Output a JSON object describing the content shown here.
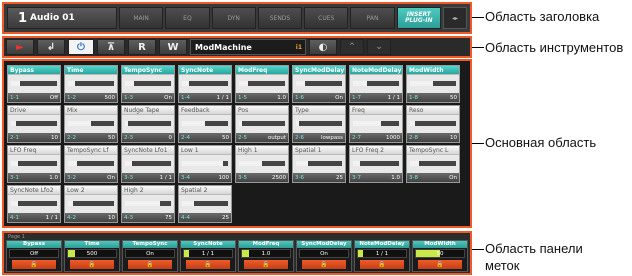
{
  "header": {
    "track_number": "1",
    "track_name": "Audio 01",
    "tabs": [
      "MAIN",
      "EQ",
      "DYN",
      "SENDS",
      "CUES",
      "PAN"
    ],
    "active_tab": "INSERT PLUG-IN",
    "meter_label": "◂▸"
  },
  "toolbar": {
    "record_icon": "►",
    "undo_icon": "↲",
    "power_icon": "⏻",
    "btn_a": "⊼",
    "btn_r": "R",
    "btn_w": "W",
    "plugin_name": "ModMachine",
    "plugin_index": "i1",
    "settings_icon": "◐",
    "up_icon": "⌃",
    "down_icon": "⌄"
  },
  "params": [
    {
      "name": "Bypass",
      "idx": "1-1",
      "val": "Off",
      "level": 0.2,
      "sel": true
    },
    {
      "name": "Time",
      "idx": "1-2",
      "val": "500",
      "level": 0.15,
      "sel": true
    },
    {
      "name": "TempoSync",
      "idx": "1-3",
      "val": "On",
      "level": 0.2,
      "sel": true
    },
    {
      "name": "SyncNote",
      "idx": "1-4",
      "val": "1 / 1",
      "level": 0.15,
      "sel": true
    },
    {
      "name": "ModFreq",
      "idx": "1-5",
      "val": "1.0",
      "level": 0.2,
      "sel": true
    },
    {
      "name": "SyncModDelay",
      "idx": "1-6",
      "val": "On",
      "level": 0.2,
      "sel": true
    },
    {
      "name": "NoteModDelay",
      "idx": "1-7",
      "val": "1 / 1",
      "level": 0.3,
      "sel": true
    },
    {
      "name": "ModWidth",
      "idx": "1-8",
      "val": "50",
      "level": 0.5,
      "sel": true
    },
    {
      "name": "Drive",
      "idx": "2-1",
      "val": "10",
      "level": 0.1,
      "sel": false
    },
    {
      "name": "Mix",
      "idx": "2-2",
      "val": "50",
      "level": 0.5,
      "sel": false
    },
    {
      "name": "Nudge Tape",
      "idx": "2-3",
      "val": "0",
      "level": 0.05,
      "sel": false
    },
    {
      "name": "Feedback",
      "idx": "2-4",
      "val": "50",
      "level": 0.5,
      "sel": false
    },
    {
      "name": "Pos",
      "idx": "2-5",
      "val": "output",
      "level": 0.05,
      "sel": false
    },
    {
      "name": "Type",
      "idx": "2-6",
      "val": "lowpass",
      "level": 0.05,
      "sel": false
    },
    {
      "name": "Freq",
      "idx": "2-7",
      "val": "1000",
      "level": 0.6,
      "sel": false
    },
    {
      "name": "Reso",
      "idx": "2-8",
      "val": "10",
      "level": 0.1,
      "sel": false
    },
    {
      "name": "LFO Freq",
      "idx": "3-1",
      "val": "1.0",
      "level": 0.15,
      "sel": false
    },
    {
      "name": "TempoSync Lf",
      "idx": "3-2",
      "val": "On",
      "level": 0.2,
      "sel": false
    },
    {
      "name": "SyncNote Lfo1",
      "idx": "3-3",
      "val": "1 / 1",
      "level": 0.15,
      "sel": false
    },
    {
      "name": "Low 1",
      "idx": "3-4",
      "val": "100",
      "level": 0.9,
      "sel": false
    },
    {
      "name": "High 1",
      "idx": "3-5",
      "val": "2500",
      "level": 0.5,
      "sel": false
    },
    {
      "name": "Spatial 1",
      "idx": "3-6",
      "val": "25",
      "level": 0.25,
      "sel": false
    },
    {
      "name": "LFO Freq 2",
      "idx": "3-7",
      "val": "1.0",
      "level": 0.15,
      "sel": false
    },
    {
      "name": "TempoSync L",
      "idx": "3-8",
      "val": "On",
      "level": 0.2,
      "sel": false
    },
    {
      "name": "SyncNote Lfo2",
      "idx": "4-1",
      "val": "1 / 1",
      "level": 0.15,
      "sel": false
    },
    {
      "name": "Low 2",
      "idx": "4-2",
      "val": "10",
      "level": 0.1,
      "sel": false
    },
    {
      "name": "High 2",
      "idx": "4-3",
      "val": "75",
      "level": 0.75,
      "sel": false
    },
    {
      "name": "Spatial 2",
      "idx": "4-4",
      "val": "25",
      "level": 0.25,
      "sel": false
    }
  ],
  "bank": {
    "label": "Page 1",
    "lock_icon": "🔒",
    "items": [
      {
        "name": "Bypass",
        "val": "Off",
        "level": 0.0
      },
      {
        "name": "Time",
        "val": "500",
        "level": 0.15
      },
      {
        "name": "TempoSync",
        "val": "On",
        "level": 0.0
      },
      {
        "name": "SyncNote",
        "val": "1 / 1",
        "level": 0.1
      },
      {
        "name": "ModFreq",
        "val": "1.0",
        "level": 0.15
      },
      {
        "name": "SyncModDelay",
        "val": "On",
        "level": 0.0
      },
      {
        "name": "NoteModDelay",
        "val": "1 / 1",
        "level": 0.1
      },
      {
        "name": "ModWidth",
        "val": "50",
        "level": 0.5
      }
    ]
  },
  "callouts": {
    "title_area": "Область заголовка",
    "tools_area": "Область инструментов",
    "main_area": "Основная область",
    "bank_area": "Область панели меток"
  }
}
